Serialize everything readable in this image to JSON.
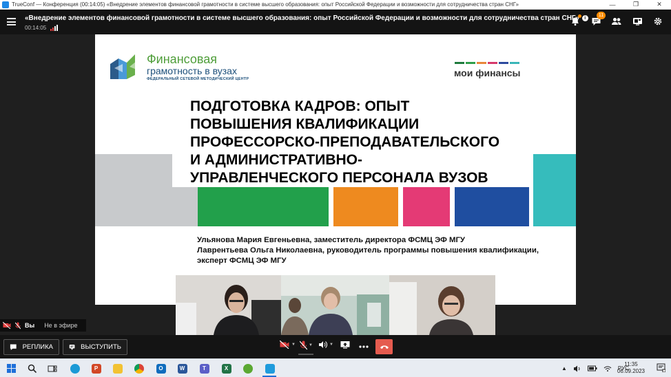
{
  "os_window": {
    "title": "TrueConf — Конференция (00:14:05) «Внедрение элементов финансовой грамотности в системе высшего образования: опыт Российской Федерации и возможности для сотрудничества стран СНГ»",
    "controls": [
      "—",
      "❐",
      "✕"
    ]
  },
  "header": {
    "conference_title": "«Внедрение элементов финансовой грамотности в системе высшего образования: опыт Российской Федерации и возможности для сотрудничества стран СНГ»",
    "info_glyph": "i",
    "timer": "00:14:05",
    "chat_badge": "11"
  },
  "slide": {
    "brand_line1": "Финансовая",
    "brand_line2": "грамотность в вузах",
    "brand_sub": "ФЕДЕРАЛЬНЫЙ СЕТЕВОЙ МЕТОДИЧЕСКИЙ ЦЕНТР",
    "partner_logo": "мои финансы",
    "partner_bar_colors": [
      "#1e7a3c",
      "#2e9e4a",
      "#e9873a",
      "#d63a6b",
      "#2c4a9e",
      "#3ab6b8"
    ],
    "heading_lines": [
      "ПОДГОТОВКА КАДРОВ: ОПЫТ",
      "ПОВЫШЕНИЯ КВАЛИФИКАЦИИ",
      "ПРОФЕССОРСКО-ПРЕПОДАВАТЕЛЬСКОГО",
      "И АДМИНИСТРАТИВНО-",
      "УПРАВЛЕНЧЕСКОГО ПЕРСОНАЛА ВУЗОВ"
    ],
    "speaker1": "Ульянова Мария Евгеньевна, заместитель директора ФСМЦ ЭФ МГУ",
    "speaker2": "Лаврентьева Ольга Николаевна, руководитель программы повышения квалификации, эксперт ФСМЦ ЭФ МГУ",
    "colors": {
      "gray": "#c8cacc",
      "green": "#22a04b",
      "orange": "#ee8a1f",
      "pink": "#e43a75",
      "blue": "#1f4ea0",
      "teal": "#36bcbc"
    }
  },
  "self_status": {
    "you_label": "Вы",
    "state": "Не в эфире"
  },
  "toolbar": {
    "reply_label": "РЕПЛИКА",
    "speak_label": "ВЫСТУПИТЬ"
  },
  "taskbar": {
    "lang": "РУС",
    "time": "11:35",
    "date": "06.09.2023"
  },
  "colors": {
    "accent_orange": "#ff8c00",
    "hangup_red": "#e55b4f",
    "muted_red": "#e04040"
  }
}
